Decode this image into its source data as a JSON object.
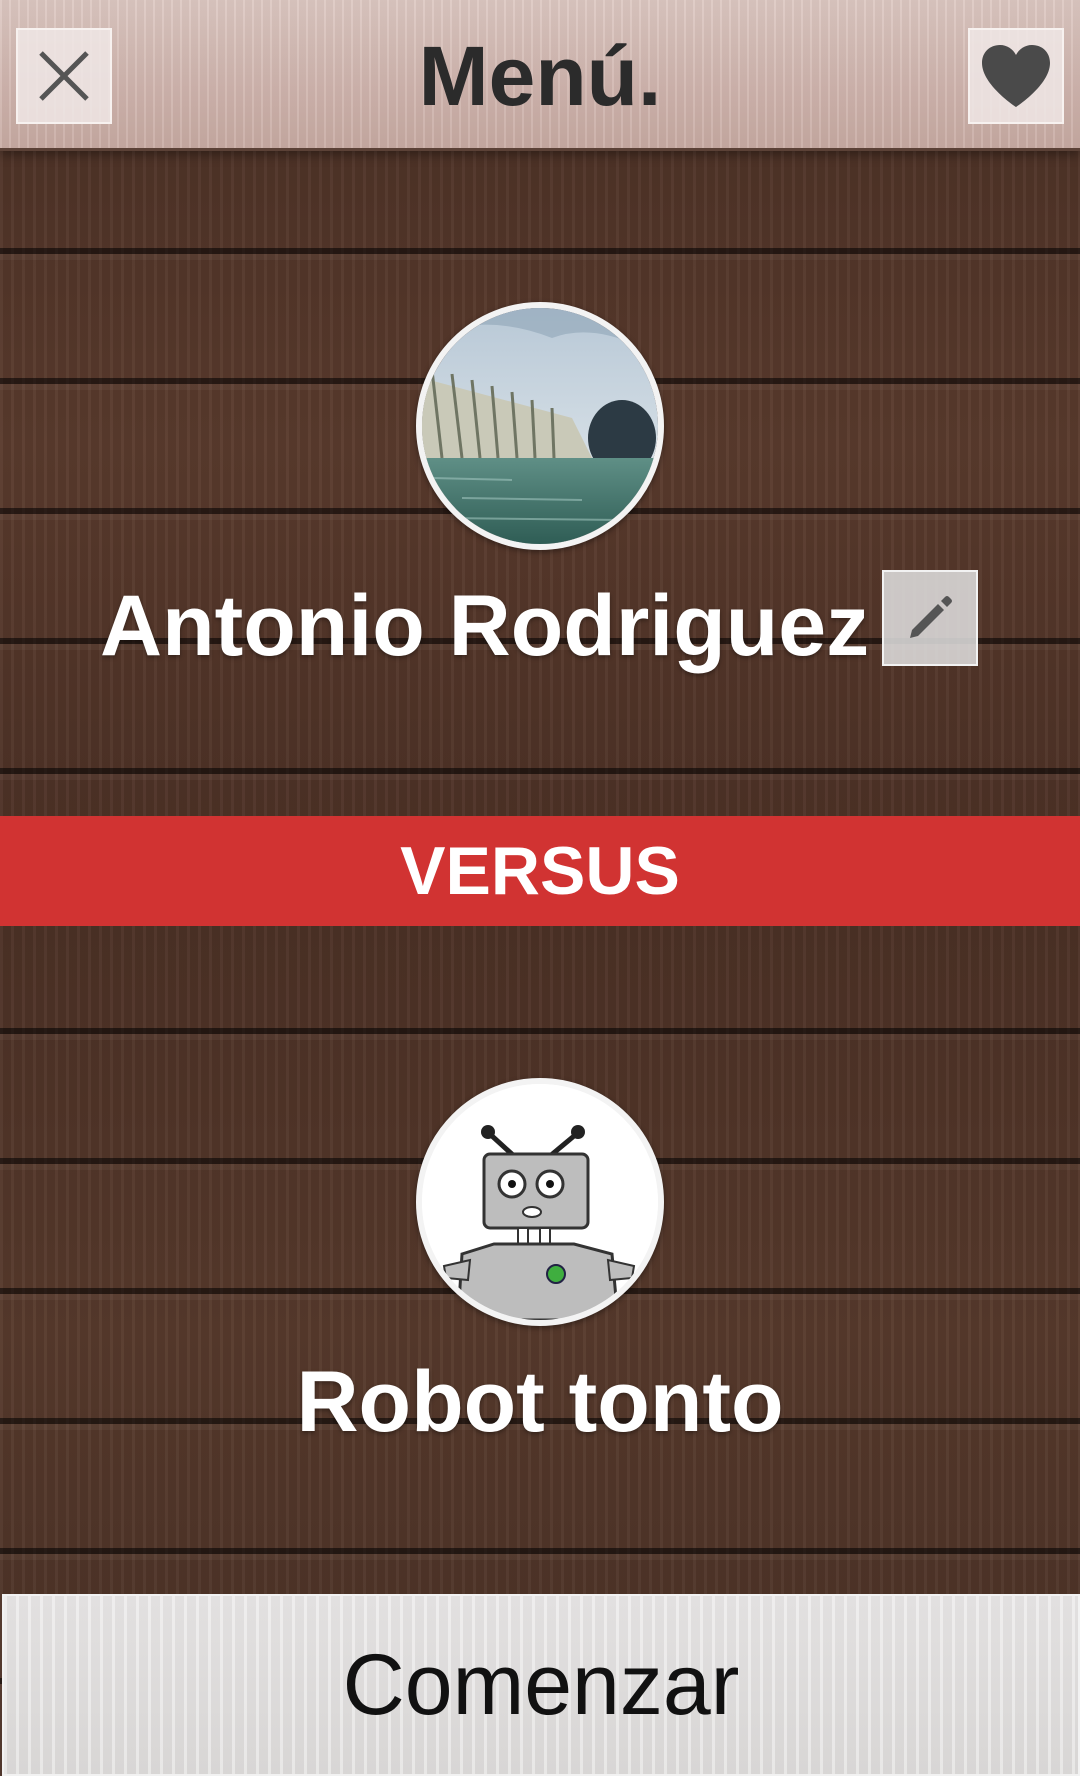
{
  "header": {
    "title": "Menú.",
    "close_icon": "close-icon",
    "favorite_icon": "heart-icon"
  },
  "player1": {
    "name": "Antonio Rodriguez",
    "avatar": "city-arts-sciences-photo",
    "edit_icon": "pencil-icon"
  },
  "versus": {
    "label": "VERSUS",
    "color": "#d13332"
  },
  "player2": {
    "name": "Robot tonto",
    "avatar": "robot-avatar"
  },
  "start_button": {
    "label": "Comenzar"
  }
}
